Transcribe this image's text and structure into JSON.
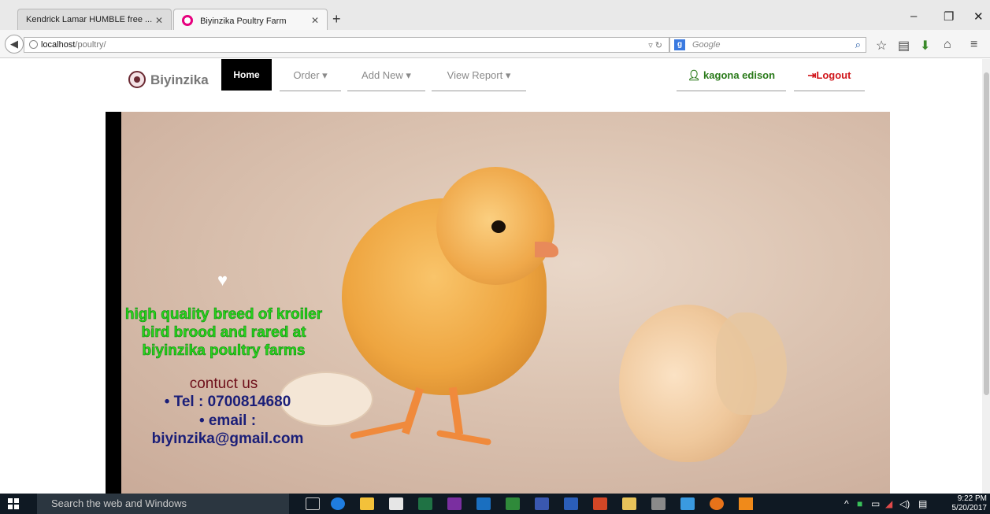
{
  "browser": {
    "tabs": [
      {
        "label": "Kendrick Lamar HUMBLE free ...",
        "active": false
      },
      {
        "label": "Biyinzika Poultry Farm",
        "active": true
      }
    ],
    "new_tab": "+",
    "url_host": "localhost",
    "url_path": "/poultry/",
    "search_placeholder": "Google",
    "window_controls": {
      "minimize": "–",
      "restore": "❐",
      "close": "✕"
    }
  },
  "site": {
    "brand": "Biyinzika",
    "nav": {
      "home": "Home",
      "order": "Order ▾",
      "add_new": "Add New ▾",
      "view_report": "View Report ▾",
      "user": "kagona edison",
      "logout": "Logout"
    },
    "hero": {
      "tagline_lines": [
        "high quality breed of kroiler",
        "bird brood and rared at",
        "biyinzika poultry farms"
      ],
      "contact_title": "contuct us",
      "tel": "• Tel : 0700814680",
      "email_label": "• email :",
      "email": "biyinzika@gmail.com"
    }
  },
  "taskbar": {
    "search_placeholder": "Search the web and Windows",
    "time": "9:22 PM",
    "date": "5/20/2017"
  },
  "colors": {
    "tagline_green": "#29d41d",
    "contact_blue": "#1a1e78",
    "contact_title_red": "#6e0f1a",
    "user_green": "#2a7a1a",
    "logout_red": "#d0161b",
    "nav_active_bg": "#000000"
  }
}
